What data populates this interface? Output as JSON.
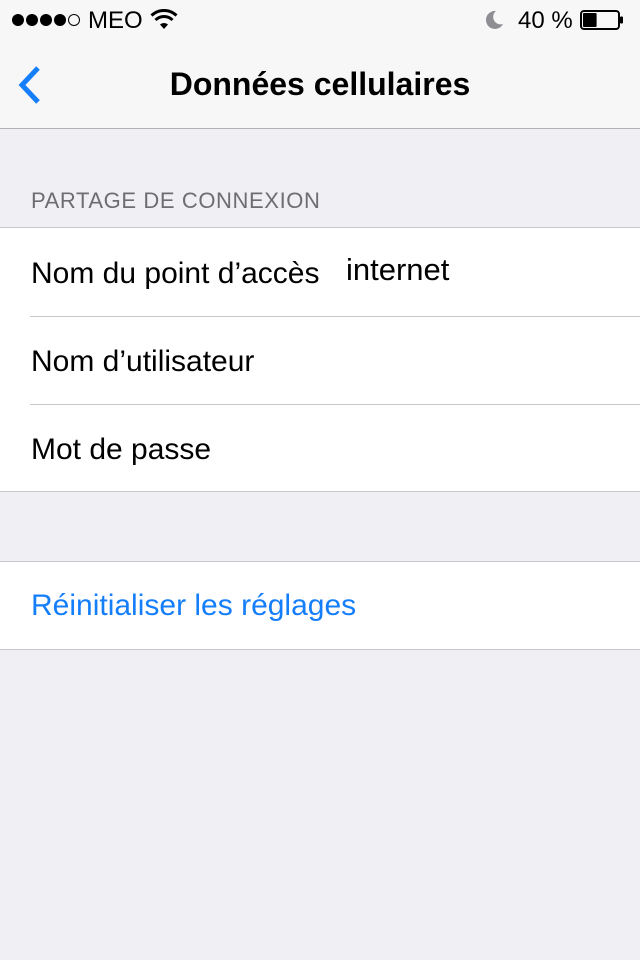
{
  "status_bar": {
    "signal_bars_filled": 4,
    "signal_bars_total": 5,
    "carrier": "MEO",
    "wifi_icon": "wifi-icon",
    "dnd_icon": "moon-icon",
    "battery_percent": "40 %",
    "battery_level": 0.4
  },
  "nav": {
    "back_icon": "chevron-left-icon",
    "title": "Données cellulaires"
  },
  "section": {
    "header": "PARTAGE DE CONNEXION",
    "rows": [
      {
        "label": "Nom du point d’accès",
        "value": "internet",
        "placeholder": ""
      },
      {
        "label": "Nom d’utilisateur",
        "value": "",
        "placeholder": ""
      },
      {
        "label": "Mot de passe",
        "value": "",
        "placeholder": ""
      }
    ]
  },
  "reset": {
    "label": "Réinitialiser les réglages"
  },
  "colors": {
    "accent": "#147efb",
    "background": "#efeff4",
    "separator": "#c8c7cc",
    "section_header": "#6d6d72"
  }
}
